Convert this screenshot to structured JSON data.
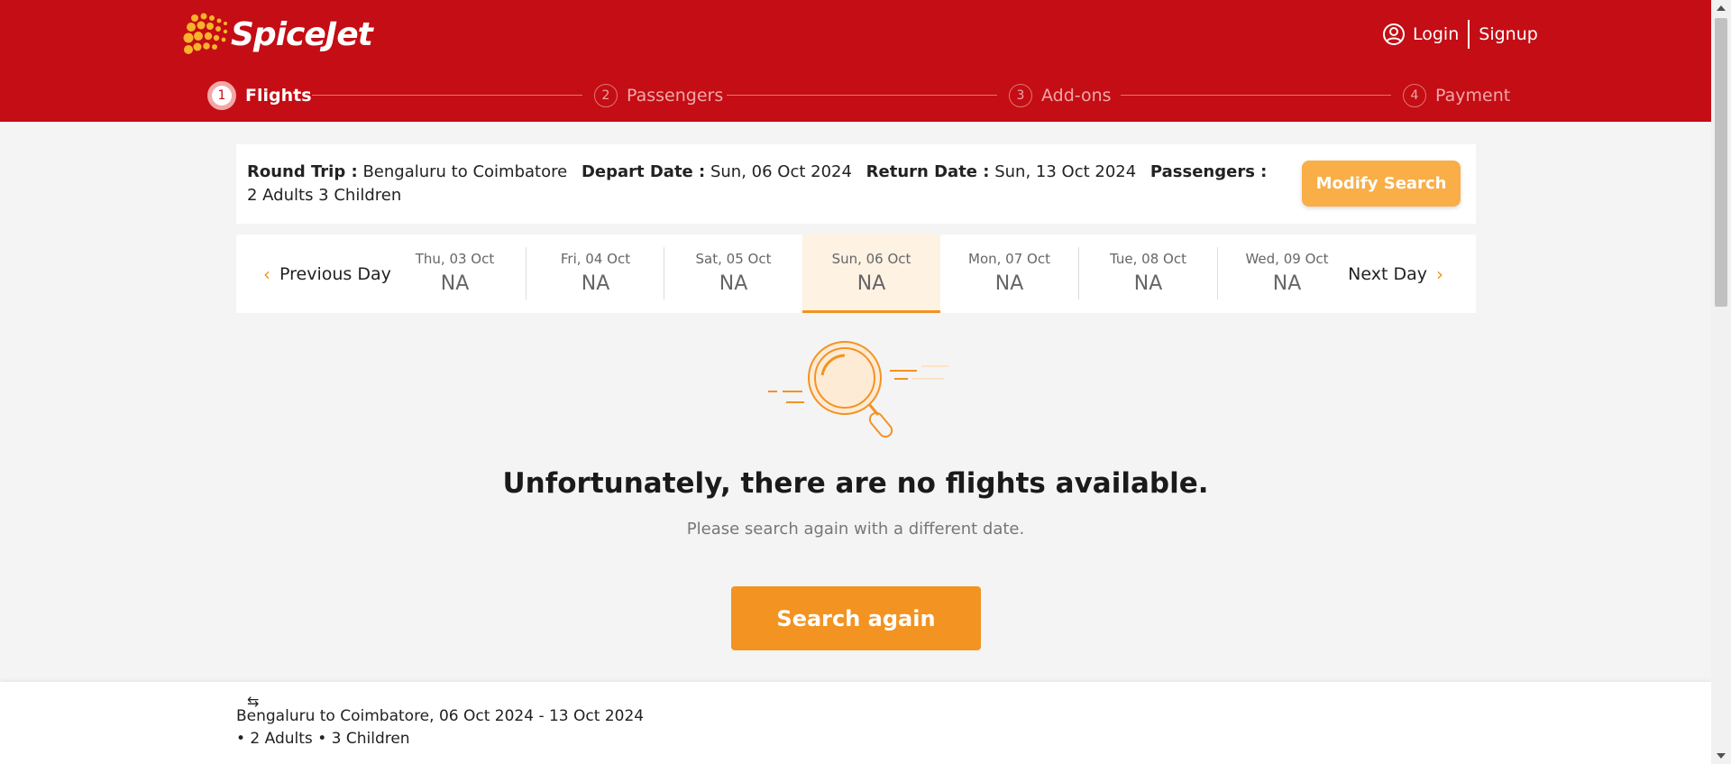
{
  "brand": {
    "name": "SpiceJet",
    "header_color": "#c40d14",
    "accent": "#f39321"
  },
  "auth": {
    "login": "Login",
    "signup": "Signup"
  },
  "stepper": [
    {
      "num": "1",
      "label": "Flights",
      "active": true
    },
    {
      "num": "2",
      "label": "Passengers",
      "active": false
    },
    {
      "num": "3",
      "label": "Add-ons",
      "active": false
    },
    {
      "num": "4",
      "label": "Payment",
      "active": false
    }
  ],
  "summary": {
    "trip_label": "Round Trip :",
    "trip_value": "Bengaluru to Coimbatore",
    "depart_label": "Depart Date :",
    "depart_value": "Sun, 06 Oct 2024",
    "return_label": "Return Date :",
    "return_value": "Sun, 13 Oct 2024",
    "pax_label": "Passengers :",
    "pax_value": "2 Adults 3 Children",
    "modify_button": "Modify Search"
  },
  "datebar": {
    "prev": "Previous Day",
    "next": "Next Day",
    "days": [
      {
        "label": "Thu, 03 Oct",
        "value": "NA"
      },
      {
        "label": "Fri, 04 Oct",
        "value": "NA"
      },
      {
        "label": "Sat, 05 Oct",
        "value": "NA"
      },
      {
        "label": "Sun, 06 Oct",
        "value": "NA",
        "selected": true
      },
      {
        "label": "Mon, 07 Oct",
        "value": "NA"
      },
      {
        "label": "Tue, 08 Oct",
        "value": "NA"
      },
      {
        "label": "Wed, 09 Oct",
        "value": "NA"
      }
    ]
  },
  "empty": {
    "title": "Unfortunately, there are no flights available.",
    "subtitle": "Please search again with a different date.",
    "button": "Search again"
  },
  "bottom": {
    "swap_icon": "⇆",
    "route": "Bengaluru to Coimbatore, 06 Oct 2024 - 13 Oct 2024",
    "pax": "• 2 Adults • 3 Children"
  }
}
